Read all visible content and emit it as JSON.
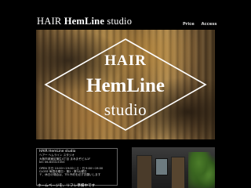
{
  "header": {
    "logo_part1": "HAIR ",
    "logo_part2": "HemLine",
    "logo_part3": " studio",
    "nav": [
      {
        "label": "Price"
      },
      {
        "label": "Access"
      }
    ]
  },
  "hero": {
    "line1": "HAIR",
    "line2": "HemLine",
    "line3": "studio"
  },
  "info": {
    "name": "HAIR HemLine studio",
    "kana": "ヘアー ヘムライン スタジオ",
    "address": "大阪市城東区蒲生4丁目 まみまぞビル1F",
    "tel": "tel: 06-6333-5353",
    "open_label": "OPEN",
    "open_hours": "平日 10:00〜19:00 / 土・日 9:00〜19:00",
    "close_label": "CLOSE",
    "close_days": "毎週月曜日・第2・第3火曜日",
    "notice": "〒、休日の場合は、TEL予約を必ずお願いします"
  },
  "bottom": {
    "message": "ホームページを、リフレ準備中です"
  },
  "colors": {
    "background": "#000000",
    "accent": "#ffffff"
  }
}
